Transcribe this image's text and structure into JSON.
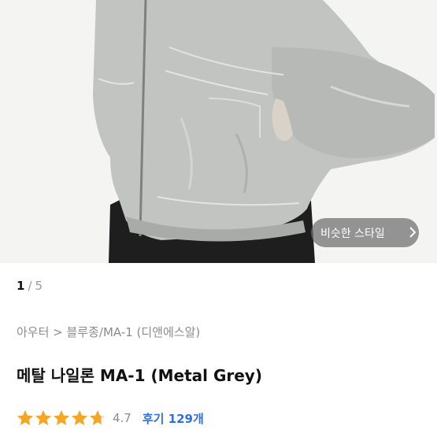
{
  "product_image": {
    "similar_style_button": "비슷한 스타일",
    "chevron_icon": "chevron-right-icon"
  },
  "pagination": {
    "current": "1",
    "separator": "/",
    "total": "5"
  },
  "breadcrumb": {
    "path": "아우터 > 블루종/MA-1 (디앤에스알)"
  },
  "product": {
    "title": "메탈 나일론 MA-1 (Metal Grey)"
  },
  "rating": {
    "stars_value": 4.7,
    "score": "4.7",
    "reviews": "후기 129개",
    "star_color": "#f5a623"
  }
}
